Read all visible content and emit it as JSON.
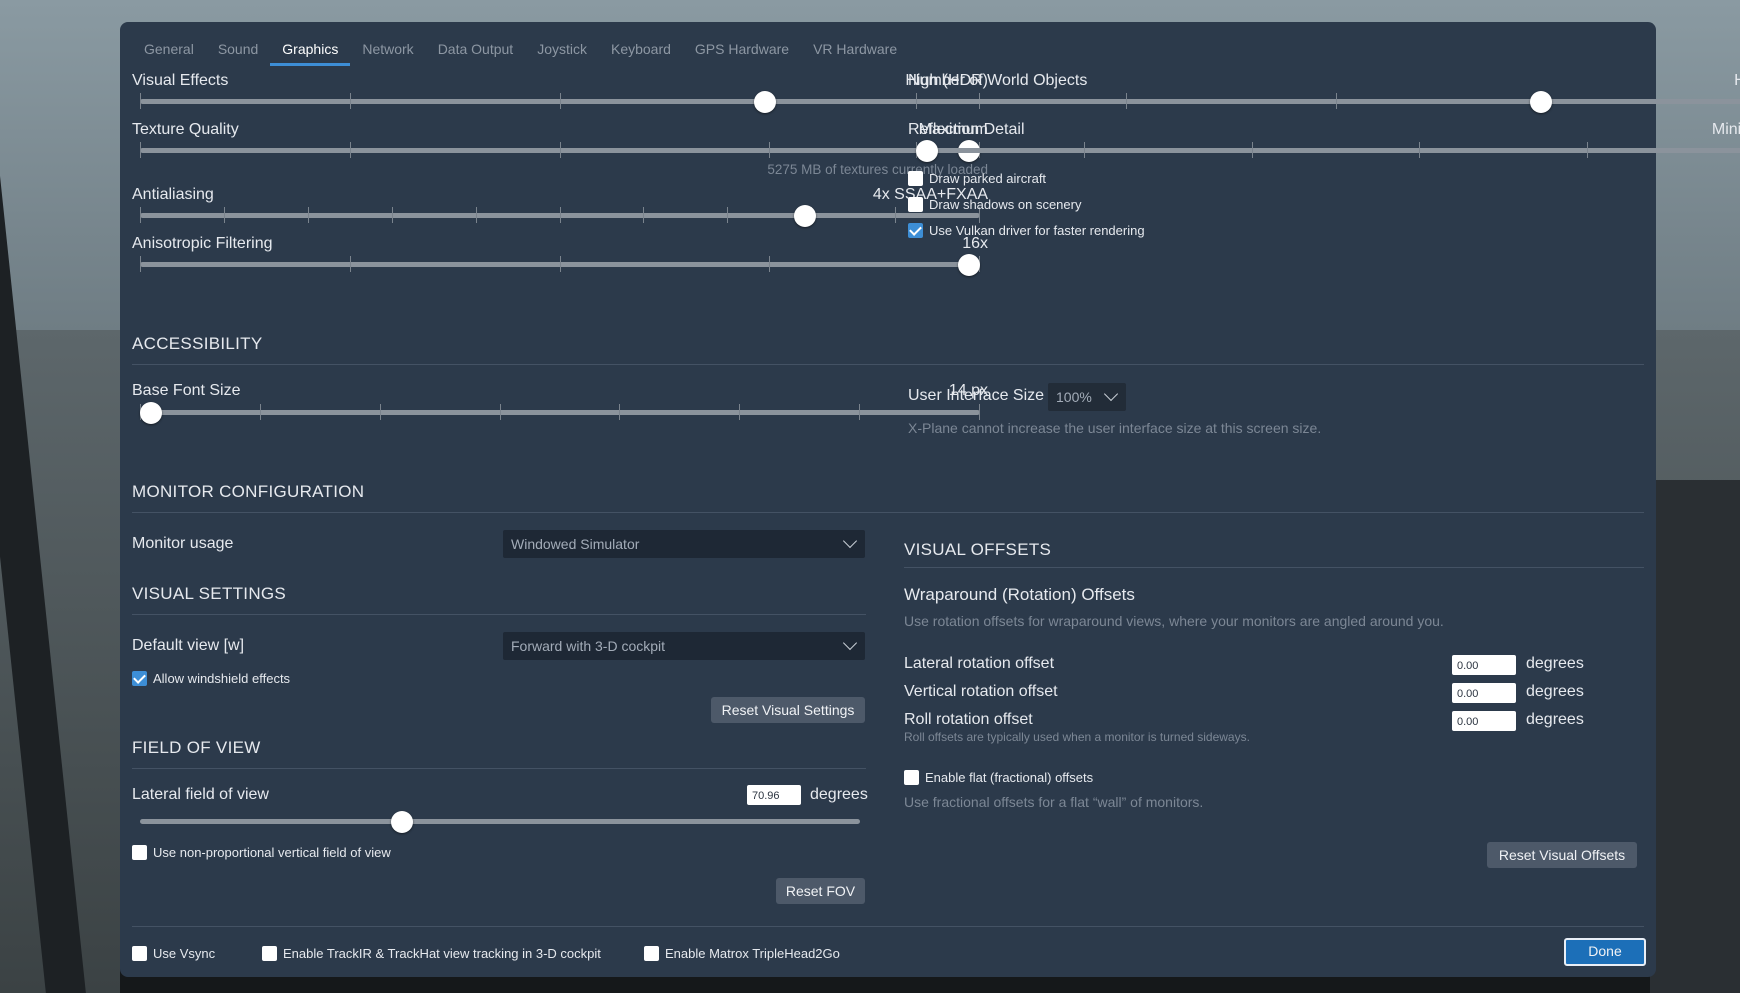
{
  "tabs": [
    "General",
    "Sound",
    "Graphics",
    "Network",
    "Data Output",
    "Joystick",
    "Keyboard",
    "GPS Hardware",
    "VR Hardware"
  ],
  "active_tab": "Graphics",
  "graphics": {
    "visual_effects": {
      "label": "Visual Effects",
      "value": "High (HDR)",
      "level": 0.75
    },
    "texture_quality": {
      "label": "Texture Quality",
      "value": "Maximum",
      "level": 1.0,
      "note": "5275 MB of textures currently loaded"
    },
    "antialiasing": {
      "label": "Antialiasing",
      "value": "4x SSAA+FXAA",
      "level": 0.8
    },
    "anisotropic": {
      "label": "Anisotropic Filtering",
      "value": "16x",
      "level": 1.0
    },
    "world_objects": {
      "label": "Number of World Objects",
      "value": "High",
      "level": 0.75
    },
    "reflection": {
      "label": "Reflection Detail",
      "value": "Minimal",
      "level": 0.0
    },
    "draw_parked": {
      "label": "Draw parked aircraft",
      "checked": false
    },
    "draw_shadows": {
      "label": "Draw shadows on scenery",
      "checked": false
    },
    "vulkan": {
      "label": "Use Vulkan driver for faster rendering",
      "checked": true
    }
  },
  "accessibility": {
    "title": "ACCESSIBILITY",
    "font_size": {
      "label": "Base Font Size",
      "value": "14 px",
      "level": 0.0
    },
    "ui_size": {
      "label": "User Interface Size",
      "value": "100%",
      "note": "X-Plane cannot increase the user interface size at this screen size."
    }
  },
  "monitor": {
    "title": "MONITOR CONFIGURATION",
    "usage_label": "Monitor usage",
    "usage_value": "Windowed Simulator"
  },
  "visual_settings": {
    "title": "VISUAL SETTINGS",
    "default_view_label": "Default view [w]",
    "default_view_value": "Forward with 3-D cockpit",
    "windshield": {
      "label": "Allow windshield effects",
      "checked": true
    },
    "reset_label": "Reset Visual Settings"
  },
  "fov": {
    "title": "FIELD OF VIEW",
    "lateral_label": "Lateral field of view",
    "lateral_value": "70.96",
    "unit": "degrees",
    "level": 0.36,
    "nonprop": {
      "label": "Use non-proportional vertical field of view",
      "checked": false
    },
    "reset_label": "Reset FOV"
  },
  "offsets": {
    "title": "VISUAL OFFSETS",
    "wrap_title": "Wraparound (Rotation) Offsets",
    "wrap_note": "Use rotation offsets for wraparound views, where your monitors are angled around you.",
    "lateral": {
      "label": "Lateral rotation offset",
      "value": "0.00",
      "unit": "degrees"
    },
    "vertical": {
      "label": "Vertical rotation offset",
      "value": "0.00",
      "unit": "degrees"
    },
    "roll": {
      "label": "Roll rotation offset",
      "value": "0.00",
      "unit": "degrees",
      "note": "Roll offsets are typically used when a monitor is turned sideways."
    },
    "flat": {
      "label": "Enable flat (fractional) offsets",
      "checked": false,
      "note": "Use fractional offsets for a flat “wall” of monitors."
    },
    "reset_label": "Reset Visual Offsets"
  },
  "footer": {
    "vsync": {
      "label": "Use Vsync",
      "checked": false
    },
    "trackir": {
      "label": "Enable TrackIR & TrackHat view tracking in 3-D cockpit",
      "checked": false
    },
    "matrox": {
      "label": "Enable Matrox TripleHead2Go",
      "checked": false
    },
    "done_label": "Done"
  },
  "colors": {
    "dialog_bg": "#2c3a4b",
    "accent": "#3d8ed6",
    "done_button": "#1c6fb8"
  }
}
